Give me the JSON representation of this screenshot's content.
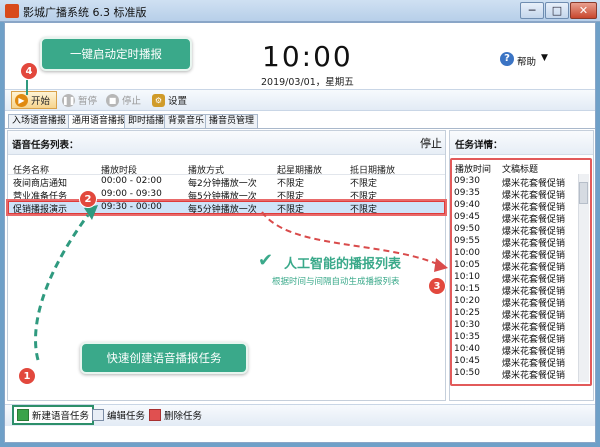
{
  "window": {
    "title": "影城广播系统 6.3 标准版",
    "min": "─",
    "max": "□",
    "close": "✕"
  },
  "header": {
    "clock": "10:00",
    "date": "2019/03/01，星期五",
    "help_label": "帮助",
    "help_icon": "?",
    "help_chevron": "▼"
  },
  "toolbar": {
    "start": "开始",
    "pause": "暂停",
    "stop": "停止",
    "settings": "设置"
  },
  "tabs": [
    "入场语音播报",
    "通用语音播报",
    "即时插播",
    "背景音乐",
    "播音员管理"
  ],
  "left_panel": {
    "title": "语音任务列表：",
    "status": "停止",
    "columns": [
      "任务名称",
      "播放时段",
      "播放方式",
      "起星期播放",
      "抵日期播放"
    ],
    "rows": [
      [
        "夜间商店通知",
        "00:00 - 02:00",
        "每2分钟播放一次",
        "不限定",
        "不限定"
      ],
      [
        "营业准备任务",
        "09:00 - 09:30",
        "每5分钟播放一次",
        "不限定",
        "不限定"
      ],
      [
        "促销播报演示",
        "09:30 - 00:00",
        "每5分钟播放一次",
        "不限定",
        "不限定"
      ]
    ]
  },
  "right_panel": {
    "title": "任务详情：",
    "columns": [
      "播放时间",
      "文稿标题"
    ],
    "rows": [
      [
        "09:30",
        "爆米花套餐促销"
      ],
      [
        "09:35",
        "爆米花套餐促销"
      ],
      [
        "09:40",
        "爆米花套餐促销"
      ],
      [
        "09:45",
        "爆米花套餐促销"
      ],
      [
        "09:50",
        "爆米花套餐促销"
      ],
      [
        "09:55",
        "爆米花套餐促销"
      ],
      [
        "10:00",
        "爆米花套餐促销"
      ],
      [
        "10:05",
        "爆米花套餐促销"
      ],
      [
        "10:10",
        "爆米花套餐促销"
      ],
      [
        "10:15",
        "爆米花套餐促销"
      ],
      [
        "10:20",
        "爆米花套餐促销"
      ],
      [
        "10:25",
        "爆米花套餐促销"
      ],
      [
        "10:30",
        "爆米花套餐促销"
      ],
      [
        "10:35",
        "爆米花套餐促销"
      ],
      [
        "10:40",
        "爆米花套餐促销"
      ],
      [
        "10:45",
        "爆米花套餐促销"
      ],
      [
        "10:50",
        "爆米花套餐促销"
      ]
    ]
  },
  "bottom_toolbar": {
    "new_task": "新建语音任务",
    "edit_task": "编辑任务",
    "delete_task": "删除任务"
  },
  "annotations": {
    "callout_start": "一键启动定时播报",
    "callout_new": "快速创建语音播报任务",
    "ai_title": "人工智能的播报列表",
    "ai_subtitle": "根据时间与间隔自动生成播报列表",
    "ai_check": "✔",
    "badges": [
      "1",
      "2",
      "3",
      "4"
    ]
  },
  "colors": {
    "accent_green": "#3aa98a",
    "badge_red": "#e2483d",
    "highlight_red": "#e03a3a",
    "selected_row": "#cfe3f8"
  }
}
